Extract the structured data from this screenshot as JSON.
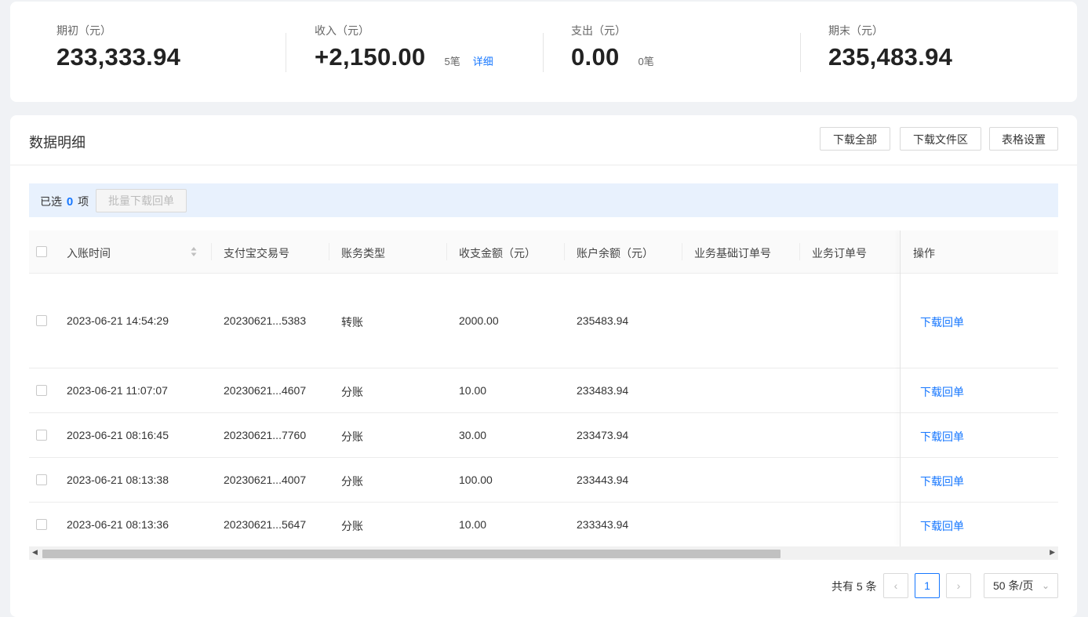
{
  "summary": {
    "opening": {
      "label": "期初（元）",
      "value": "233,333.94"
    },
    "income": {
      "label": "收入（元）",
      "value": "+2,150.00",
      "count": "5笔",
      "detail": "详细"
    },
    "expense": {
      "label": "支出（元）",
      "value": "0.00",
      "count": "0笔"
    },
    "closing": {
      "label": "期末（元）",
      "value": "235,483.94"
    }
  },
  "section": {
    "title": "数据明细",
    "buttons": {
      "download_all": "下载全部",
      "download_area": "下载文件区",
      "table_settings": "表格设置"
    }
  },
  "selection": {
    "prefix": "已选",
    "count": "0",
    "suffix": "项",
    "bulk_button": "批量下载回单"
  },
  "table": {
    "columns": [
      "入账时间",
      "支付宝交易号",
      "账务类型",
      "收支金额（元）",
      "账户余额（元）",
      "业务基础订单号",
      "业务订单号",
      "操作"
    ],
    "rows": [
      {
        "time": "2023-06-21 14:54:29",
        "trade_no": "20230621...5383",
        "type": "转账",
        "amount": "2000.00",
        "balance": "235483.94",
        "base_order": "",
        "order": "",
        "action": "下载回单"
      },
      {
        "time": "2023-06-21 11:07:07",
        "trade_no": "20230621...4607",
        "type": "分账",
        "amount": "10.00",
        "balance": "233483.94",
        "base_order": "",
        "order": "",
        "action": "下载回单"
      },
      {
        "time": "2023-06-21 08:16:45",
        "trade_no": "20230621...7760",
        "type": "分账",
        "amount": "30.00",
        "balance": "233473.94",
        "base_order": "",
        "order": "",
        "action": "下载回单"
      },
      {
        "time": "2023-06-21 08:13:38",
        "trade_no": "20230621...4007",
        "type": "分账",
        "amount": "100.00",
        "balance": "233443.94",
        "base_order": "",
        "order": "",
        "action": "下载回单"
      },
      {
        "time": "2023-06-21 08:13:36",
        "trade_no": "20230621...5647",
        "type": "分账",
        "amount": "10.00",
        "balance": "233343.94",
        "base_order": "",
        "order": "",
        "action": "下载回单"
      }
    ]
  },
  "pagination": {
    "total": "共有 5 条",
    "current_page": "1",
    "page_size": "50 条/页"
  },
  "colors": {
    "accent": "#1677ff",
    "selection_bg": "#e8f1fd"
  }
}
